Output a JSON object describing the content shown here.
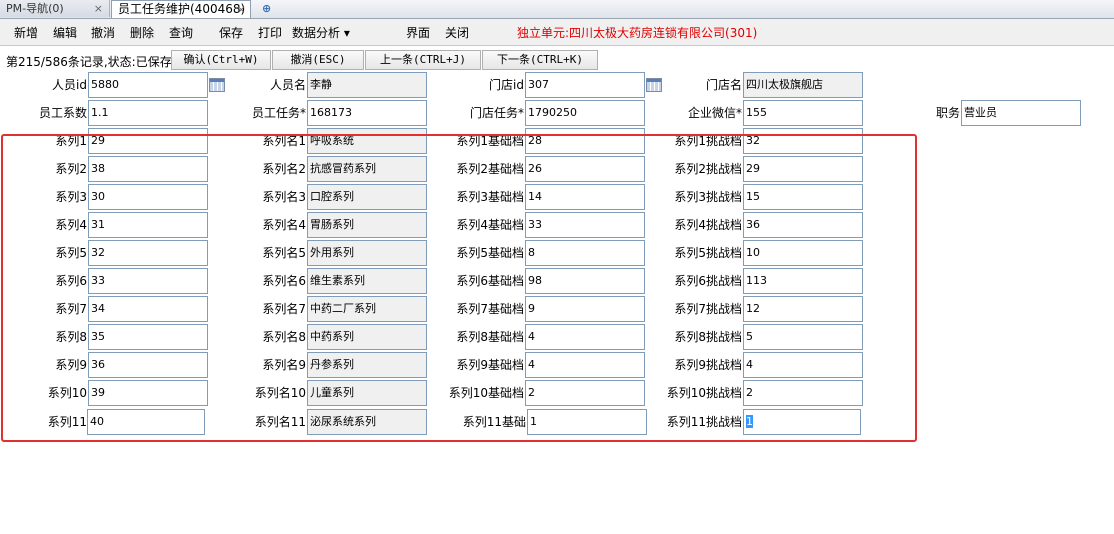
{
  "tabs": [
    {
      "label": "PM-导航(0)",
      "close": "×"
    },
    {
      "label": "员工任务维护(400468)",
      "close": "×"
    },
    {
      "label": "⊕"
    }
  ],
  "toolbar": {
    "items": [
      "新增",
      "编辑",
      "撤消",
      "删除",
      "查询",
      "保存",
      "打印",
      "数据分析 ▾",
      "界面",
      "关闭"
    ],
    "company": "独立单元:四川太极大药房连锁有限公司(301)"
  },
  "status": {
    "text": "第215/586条记录,状态:已保存",
    "buttons": [
      "确认(Ctrl+W)",
      "撤消(ESC)",
      "上一条(CTRL+J)",
      "下一条(CTRL+K)"
    ]
  },
  "header_rows": [
    [
      {
        "label": "人员id",
        "value": "5880",
        "cal": true
      },
      {
        "label": "人员名",
        "value": "李静",
        "ro": true
      },
      {
        "label": "门店id",
        "value": "307",
        "cal": true
      },
      {
        "label": "门店名",
        "value": "四川太极旗舰店",
        "ro": true
      }
    ],
    [
      {
        "label": "员工系数",
        "value": "1.1"
      },
      {
        "label": "员工任务*",
        "value": "168173"
      },
      {
        "label": "门店任务*",
        "value": "1790250"
      },
      {
        "label": "企业微信*",
        "value": "155"
      },
      {
        "label": "职务",
        "value": "营业员"
      }
    ]
  ],
  "series_rows": [
    {
      "l1": "系列1",
      "v1": "29",
      "l2": "系列名1",
      "v2": "呼吸系统",
      "l3": "系列1基础档",
      "v3": "28",
      "l4": "系列1挑战档",
      "v4": "32"
    },
    {
      "l1": "系列2",
      "v1": "38",
      "l2": "系列名2",
      "v2": "抗感冒药系列",
      "l3": "系列2基础档",
      "v3": "26",
      "l4": "系列2挑战档",
      "v4": "29"
    },
    {
      "l1": "系列3",
      "v1": "30",
      "l2": "系列名3",
      "v2": "口腔系列",
      "l3": "系列3基础档",
      "v3": "14",
      "l4": "系列3挑战档",
      "v4": "15"
    },
    {
      "l1": "系列4",
      "v1": "31",
      "l2": "系列名4",
      "v2": "胃肠系列",
      "l3": "系列4基础档",
      "v3": "33",
      "l4": "系列4挑战档",
      "v4": "36"
    },
    {
      "l1": "系列5",
      "v1": "32",
      "l2": "系列名5",
      "v2": "外用系列",
      "l3": "系列5基础档",
      "v3": "8",
      "l4": "系列5挑战档",
      "v4": "10"
    },
    {
      "l1": "系列6",
      "v1": "33",
      "l2": "系列名6",
      "v2": "维生素系列",
      "l3": "系列6基础档",
      "v3": "98",
      "l4": "系列6挑战档",
      "v4": "113"
    },
    {
      "l1": "系列7",
      "v1": "34",
      "l2": "系列名7",
      "v2": "中药二厂系列",
      "l3": "系列7基础档",
      "v3": "9",
      "l4": "系列7挑战档",
      "v4": "12"
    },
    {
      "l1": "系列8",
      "v1": "35",
      "l2": "系列名8",
      "v2": "中药系列",
      "l3": "系列8基础档",
      "v3": "4",
      "l4": "系列8挑战档",
      "v4": "5"
    },
    {
      "l1": "系列9",
      "v1": "36",
      "l2": "系列名9",
      "v2": "丹参系列",
      "l3": "系列9基础档",
      "v3": "4",
      "l4": "系列9挑战档",
      "v4": "4"
    },
    {
      "l1": "系列10",
      "v1": "39",
      "l2": "系列名10",
      "v2": "儿童系列",
      "l3": "系列10基础档",
      "v3": "2",
      "l4": "系列10挑战档",
      "v4": "2"
    },
    {
      "l1": "系列11",
      "v1": "40",
      "l2": "系列名11",
      "v2": "泌尿系统系列",
      "l3": "系列11基础",
      "v3": "1",
      "l4": "系列11挑战档",
      "v4": "1"
    }
  ]
}
